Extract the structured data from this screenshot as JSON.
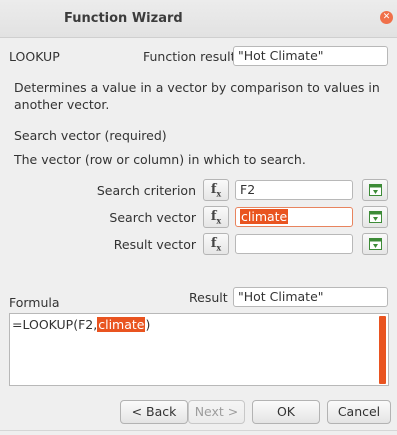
{
  "window": {
    "title": "Function Wizard",
    "close_icon": "close-icon"
  },
  "function": {
    "name": "LOOKUP",
    "result_label": "Function result",
    "result_value": "\"Hot Climate\"",
    "description": "Determines a value in a vector by comparison to values in another vector."
  },
  "argument": {
    "name": "Search vector (required)",
    "description": "The vector (row or column) in which to search."
  },
  "params": [
    {
      "label": "Search criterion",
      "value": "F2"
    },
    {
      "label": "Search vector",
      "value": "climate"
    },
    {
      "label": "Result vector",
      "value": ""
    }
  ],
  "fx_label": "f",
  "fx_sub": "x",
  "formula": {
    "label": "Formula",
    "result_label": "Result",
    "result_value": "\"Hot Climate\"",
    "text_prefix": "=LOOKUP(F2,",
    "text_selected": "climate",
    "text_suffix": ")"
  },
  "buttons": {
    "back": "< Back",
    "next": "Next >",
    "ok": "OK",
    "cancel": "Cancel"
  },
  "colors": {
    "accent": "#e95420",
    "shrink_icon": "#3d8b37"
  }
}
